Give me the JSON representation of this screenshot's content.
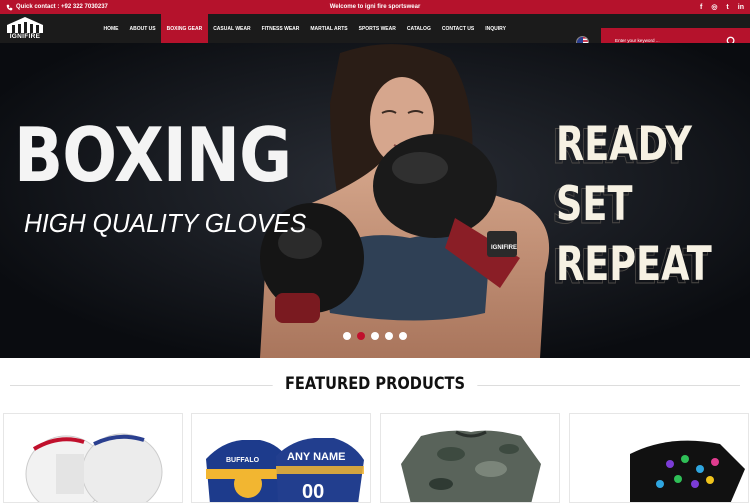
{
  "topbar": {
    "quick_contact": "Quick contact : +92 322 7030237",
    "welcome": "Welcome to igni fire sportswear",
    "social_icons": [
      "facebook-icon",
      "instagram-icon",
      "twitter-icon",
      "linkedin-icon"
    ],
    "social_glyphs": [
      "f",
      "◎",
      "t",
      "in"
    ]
  },
  "logo": {
    "text": "IGNIFIRE"
  },
  "nav": {
    "items": [
      "HOME",
      "ABOUT US",
      "BOXING GEAR",
      "CASUAL WEAR",
      "FITNESS WEAR",
      "MARTIAL ARTS",
      "SPORTS WEAR",
      "CATALOG",
      "CONTACT US",
      "INQUIRY"
    ],
    "active_index": 2
  },
  "search": {
    "placeholder": "Enter your keyword ..."
  },
  "hero": {
    "headline": "BOXING",
    "subline": "HIGH QUALITY GLOVES",
    "slogan": [
      "READY",
      "SET",
      "REPEAT"
    ],
    "glove_brand": "IGNIFIRE",
    "slide_count": 5,
    "active_slide": 1
  },
  "featured": {
    "title": "FEATURED PRODUCTS",
    "products": [
      {
        "name": "boxing-gloves-white"
      },
      {
        "name": "hockey-jersey",
        "jersey_texts": [
          "BUFFALO",
          "ANY NAME",
          "00"
        ]
      },
      {
        "name": "camo-sweatshirt"
      },
      {
        "name": "printed-face-mask"
      }
    ]
  },
  "colors": {
    "brand_red": "#b5122c",
    "nav_dark": "#1b1b1b",
    "hero_bg": "#0c0f14",
    "slogan": "#f6f1e3"
  }
}
